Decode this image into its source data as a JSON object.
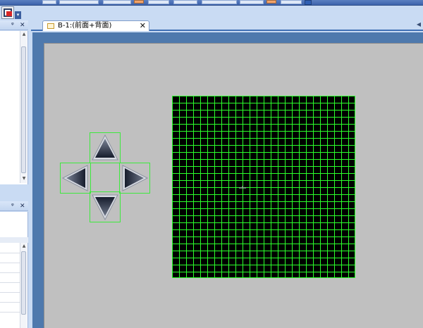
{
  "document_tab": {
    "label": "B-1:(前面+背面)",
    "close_symbol": "✕"
  },
  "left_panels": [
    {
      "pin_symbol": "ᵠ",
      "close_symbol": "✕"
    },
    {
      "pin_symbol": "ᵠ",
      "close_symbol": "✕"
    }
  ],
  "icons": {
    "toolbar_paint": "paint-picture-icon",
    "panel_pin": "pin-icon",
    "panel_close": "close-icon",
    "tab_document": "document-icon",
    "tab_close": "close-icon",
    "tab_scroll": "chevron-left-icon",
    "dir_up": "arrow-up-icon",
    "dir_left": "arrow-left-icon",
    "dir_right": "arrow-right-icon",
    "dir_down": "arrow-down-icon",
    "cursor": "cursor-icon"
  },
  "colors": {
    "led_grid_line": "#2bff2b",
    "led_background": "#000000",
    "selection_outline": "#3dea3d",
    "canvas": "#c0c0c0",
    "workspace_frame": "#4e79ad"
  }
}
